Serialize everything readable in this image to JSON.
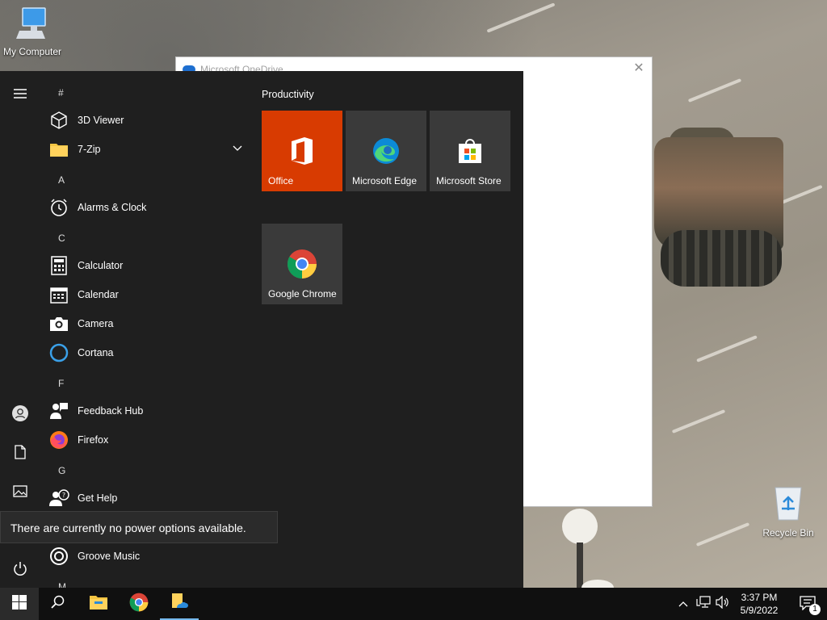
{
  "desktop": {
    "icons": [
      {
        "label": "My Computer",
        "icon": "computer-icon"
      },
      {
        "label": "Recycle Bin",
        "icon": "recycle-bin-icon"
      }
    ]
  },
  "onedrive_window": {
    "title": "Microsoft OneDrive",
    "close_label": "✕"
  },
  "start_menu": {
    "rail": [
      {
        "name": "hamburger-menu-icon"
      },
      {
        "name": "user-account-icon"
      },
      {
        "name": "documents-icon"
      },
      {
        "name": "pictures-icon"
      },
      {
        "name": "power-icon"
      }
    ],
    "app_list": {
      "headers": {
        "hash": "#",
        "a": "A",
        "c": "C",
        "f": "F",
        "g": "G",
        "m": "M"
      },
      "apps": {
        "viewer3d": "3D Viewer",
        "zip7": "7-Zip",
        "alarms": "Alarms & Clock",
        "calculator": "Calculator",
        "calendar": "Calendar",
        "camera": "Camera",
        "cortana": "Cortana",
        "feedback": "Feedback Hub",
        "firefox": "Firefox",
        "gethelp": "Get Help",
        "groove": "Groove Music"
      }
    },
    "tiles": {
      "group_title": "Productivity",
      "office": "Office",
      "edge": "Microsoft Edge",
      "store": "Microsoft Store",
      "chrome": "Google Chrome"
    },
    "power_tooltip": "There are currently no power options available."
  },
  "taskbar": {
    "clock_time": "3:37 PM",
    "clock_date": "5/9/2022",
    "notification_count": "1"
  },
  "colors": {
    "start_bg": "#1f1f1f",
    "taskbar_bg": "#101010",
    "office_tile": "#d83b01",
    "tile_bg": "#3a3a3a",
    "accent": "#76b9ed"
  }
}
